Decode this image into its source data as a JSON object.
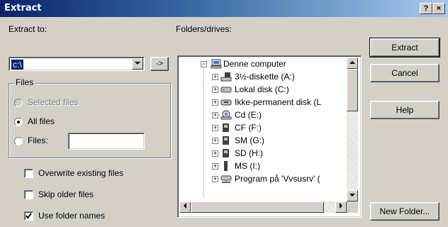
{
  "window": {
    "title": "Extract",
    "help_btn": "?",
    "close_btn": "×"
  },
  "extract_to": {
    "label": "Extract to:",
    "value": "c:\\",
    "browse_btn": "->"
  },
  "files_group": {
    "title": "Files",
    "options": [
      {
        "label": "Selected files",
        "enabled": false,
        "selected": false
      },
      {
        "label": "All files",
        "enabled": true,
        "selected": true
      },
      {
        "label": "Files:",
        "enabled": true,
        "selected": false
      }
    ],
    "files_value": ""
  },
  "checkboxes": [
    {
      "label": "Overwrite existing files",
      "checked": false
    },
    {
      "label": "Skip older files",
      "checked": false
    },
    {
      "label": "Use folder names",
      "checked": true
    }
  ],
  "folders": {
    "label": "Folders/drives:",
    "root": {
      "label": "Denne computer",
      "icon": "computer-icon"
    },
    "items": [
      {
        "label": "3½-diskette (A:)",
        "icon": "floppy-icon"
      },
      {
        "label": "Lokal disk (C:)",
        "icon": "hard-disk-icon"
      },
      {
        "label": "Ikke-permanent disk (L",
        "icon": "removable-disk-icon"
      },
      {
        "label": "Cd (E:)",
        "icon": "cd-drive-icon"
      },
      {
        "label": "CF (F:)",
        "icon": "card-reader-icon"
      },
      {
        "label": "SM (G:)",
        "icon": "card-reader-icon"
      },
      {
        "label": "SD (H:)",
        "icon": "card-reader-icon"
      },
      {
        "label": "MS (I:)",
        "icon": "memory-stick-icon"
      },
      {
        "label": "Program på 'Vvsusrv' (",
        "icon": "network-drive-icon"
      }
    ]
  },
  "buttons": {
    "extract": "Extract",
    "cancel": "Cancel",
    "help": "Help",
    "new_folder": "New Folder..."
  }
}
